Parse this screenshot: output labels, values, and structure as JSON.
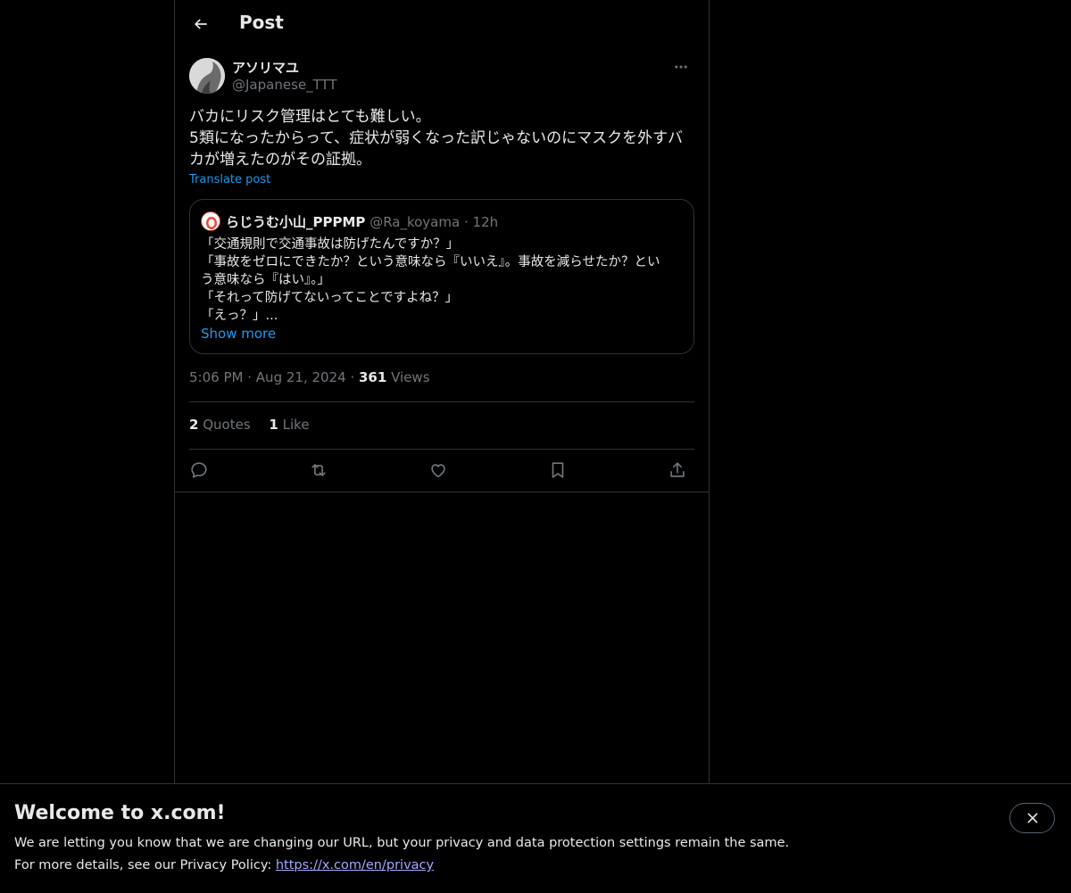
{
  "header": {
    "title": "Post"
  },
  "post": {
    "author_name": "アソリマユ",
    "author_handle": "@Japanese_TTT",
    "text_lines": [
      "バカにリスク管理はとても難しい。",
      "5類になったからって、症状が弱くなった訳じゃないのにマスクを外すバ",
      "カが増えたのがその証拠。"
    ],
    "translate_label": "Translate post",
    "time": "5:06 PM",
    "date": "Aug 21, 2024",
    "views_count": "361",
    "views_label": "Views",
    "sep": "·"
  },
  "quote": {
    "name": "らじうむ小山_PPPMP",
    "handle": "@Ra_koyama",
    "sep": "·",
    "time": "12h",
    "lines": [
      "「交通規則で交通事故は防げたんですか？」",
      "「事故をゼロにできたか？という意味なら『いいえ』。事故を減らせたか？とい",
      "う意味なら『はい』。」",
      "「それって防げてないってことですよね？」",
      "「えっ？」..."
    ],
    "show_more": "Show more"
  },
  "stats": {
    "quotes_count": "2",
    "quotes_label": "Quotes",
    "likes_count": "1",
    "likes_label": "Like"
  },
  "icons": {
    "back": "arrow-left-icon",
    "more": "more-horizontal-icon",
    "reply": "reply-icon",
    "repost": "repost-icon",
    "like": "heart-icon",
    "bookmark": "bookmark-icon",
    "share": "share-icon",
    "close": "close-icon"
  },
  "banner": {
    "title": "Welcome to x.com!",
    "line1": "We are letting you know that we are changing our URL, but your privacy and data protection settings remain the same.",
    "line2_prefix": "For more details, see our Privacy Policy: ",
    "link": "https://x.com/en/privacy"
  },
  "colors": {
    "background": "#000000",
    "text": "#e7e9ea",
    "secondary": "#71767b",
    "accent": "#1d9bf0",
    "border": "#2f3336",
    "link": "#a4a7ff"
  }
}
